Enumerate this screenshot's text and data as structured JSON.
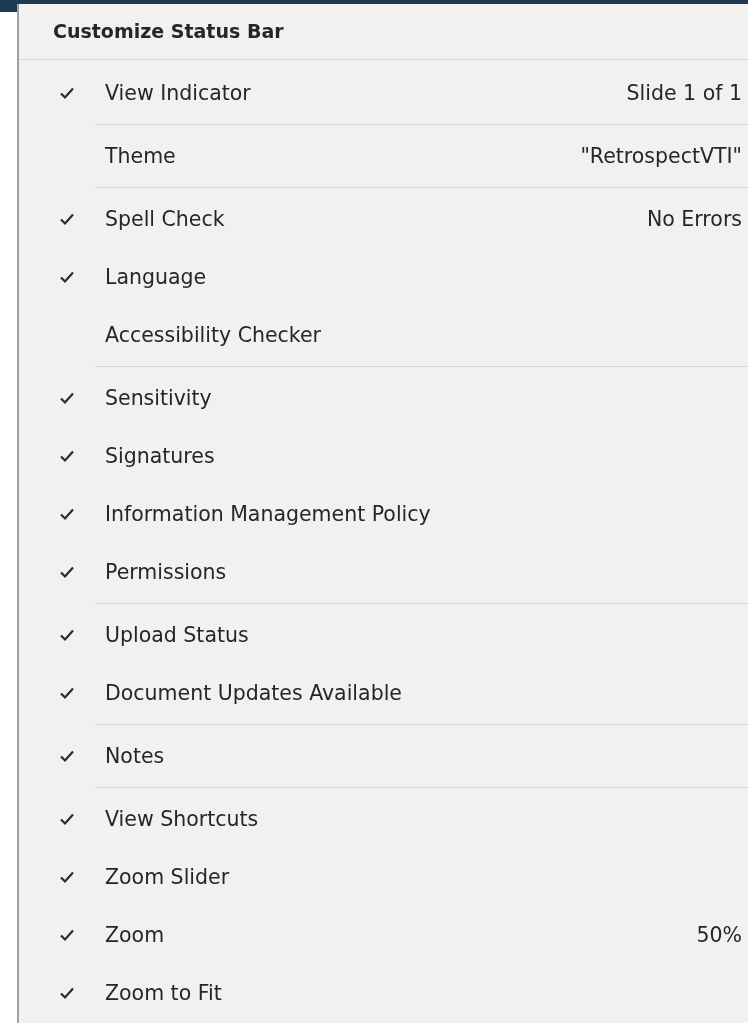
{
  "menu": {
    "title": "Customize Status Bar",
    "groups": [
      {
        "items": [
          {
            "label": "View Indicator",
            "checked": true,
            "value": "Slide 1 of 1"
          }
        ]
      },
      {
        "items": [
          {
            "label": "Theme",
            "checked": false,
            "value": "\"RetrospectVTI\""
          }
        ]
      },
      {
        "items": [
          {
            "label": "Spell Check",
            "checked": true,
            "value": "No Errors"
          },
          {
            "label": "Language",
            "checked": true
          },
          {
            "label": "Accessibility Checker",
            "checked": false
          }
        ]
      },
      {
        "items": [
          {
            "label": "Sensitivity",
            "checked": true
          },
          {
            "label": "Signatures",
            "checked": true
          },
          {
            "label": "Information Management Policy",
            "checked": true
          },
          {
            "label": "Permissions",
            "checked": true
          }
        ]
      },
      {
        "items": [
          {
            "label": "Upload Status",
            "checked": true
          },
          {
            "label": "Document Updates Available",
            "checked": true
          }
        ]
      },
      {
        "items": [
          {
            "label": "Notes",
            "checked": true
          }
        ]
      },
      {
        "items": [
          {
            "label": "View Shortcuts",
            "checked": true
          },
          {
            "label": "Zoom Slider",
            "checked": true
          },
          {
            "label": "Zoom",
            "checked": true,
            "value": "50%"
          },
          {
            "label": "Zoom to Fit",
            "checked": true
          }
        ]
      }
    ]
  }
}
